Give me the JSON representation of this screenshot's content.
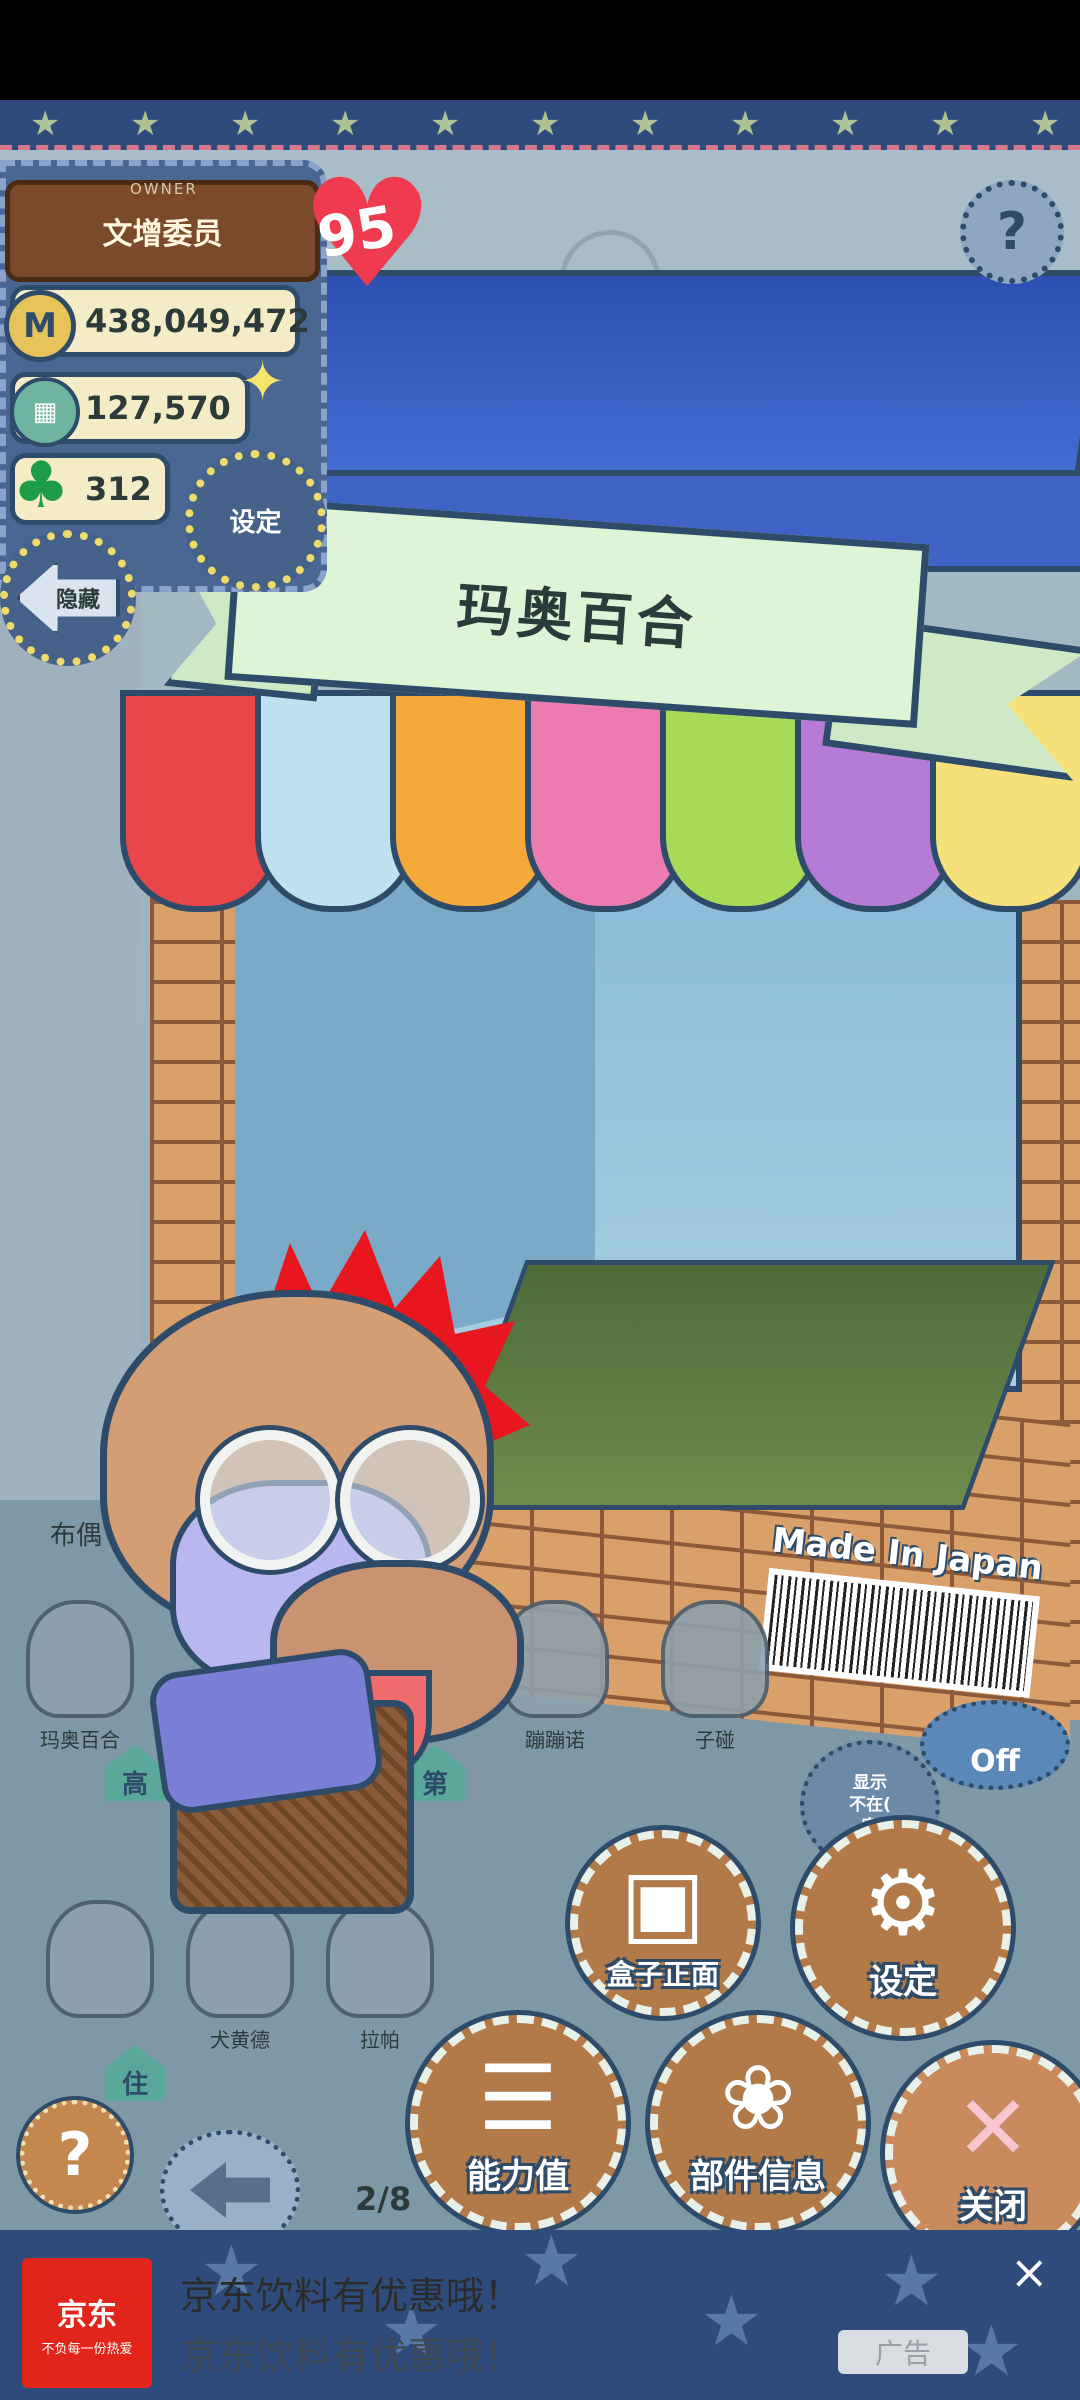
{
  "owner": {
    "tag": "OWNER",
    "name": "文增委员",
    "level": "95",
    "coins": "438,049,472",
    "coin_icon_letter": "M",
    "food": "127,570",
    "clover": "312"
  },
  "buttons": {
    "settings_small": "设定",
    "hide": "隐藏",
    "help": "?"
  },
  "stall": {
    "banner_title": "玛奥百合",
    "made_in": "Made In Japan"
  },
  "members": {
    "section_label": "布偶",
    "items": [
      {
        "label": "玛奥百合",
        "house": "高"
      },
      {
        "label": "蹦蹦诺",
        "house": "第"
      },
      {
        "label": "子碰",
        "house": ""
      },
      {
        "label": "",
        "house": "住"
      },
      {
        "label": "犬黄德",
        "house": ""
      },
      {
        "label": "拉帕",
        "house": ""
      }
    ],
    "status_badge": "显示\n不在(\n家",
    "off_badge": "Off",
    "page_indicator": "2/8"
  },
  "actions": {
    "box_front": "盒子正面",
    "settings": "设定",
    "stats": "能力值",
    "parts_info": "部件信息",
    "close": "关闭"
  },
  "ad": {
    "logo_text": "京东",
    "logo_slogan": "不负每一份热爱",
    "line1": "京东饮料有优惠哦！",
    "line2": "京东饮料有优惠哦！",
    "tag": "广告",
    "close": "×"
  },
  "colors": {
    "awning": [
      "#e8464a",
      "#bfe0ee",
      "#f5a93a",
      "#ec7bb0",
      "#a8d957",
      "#b67bd6",
      "#f5e07a"
    ],
    "outline": "#2e4c6a",
    "ad_brand": "#e1251b"
  }
}
